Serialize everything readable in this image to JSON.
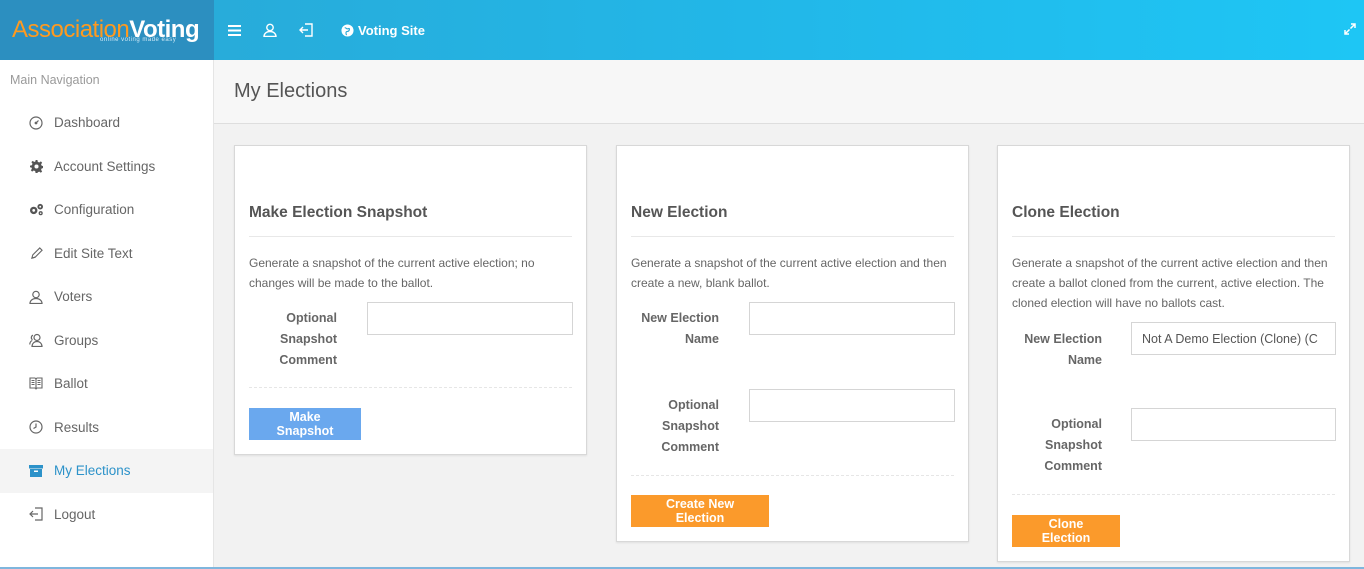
{
  "brand": {
    "part1": "Association",
    "part2": "Voting",
    "tagline": "online voting made easy"
  },
  "topbar": {
    "voting_site": "Voting Site"
  },
  "sidebar": {
    "header": "Main Navigation",
    "items": [
      {
        "label": "Dashboard",
        "icon": "dashboard-icon"
      },
      {
        "label": "Account Settings",
        "icon": "gear-icon"
      },
      {
        "label": "Configuration",
        "icon": "gears-icon"
      },
      {
        "label": "Edit Site Text",
        "icon": "pencil-icon"
      },
      {
        "label": "Voters",
        "icon": "user-icon"
      },
      {
        "label": "Groups",
        "icon": "users-icon"
      },
      {
        "label": "Ballot",
        "icon": "book-icon"
      },
      {
        "label": "Results",
        "icon": "clock-icon"
      },
      {
        "label": "My Elections",
        "icon": "archive-icon",
        "active": true
      },
      {
        "label": "Logout",
        "icon": "logout-icon"
      }
    ]
  },
  "page": {
    "title": "My Elections"
  },
  "cards": {
    "snapshot": {
      "title": "Make Election Snapshot",
      "description": "Generate a snapshot of the current active election; no changes will be made to the ballot.",
      "comment_label": "Optional Snapshot Comment",
      "comment_value": "",
      "button": "Make Snapshot"
    },
    "new_election": {
      "title": "New Election",
      "description": "Generate a snapshot of the current active election and then create a new, blank ballot.",
      "name_label": "New Election Name",
      "name_value": "",
      "comment_label": "Optional Snapshot Comment",
      "comment_value": "",
      "button": "Create New Election"
    },
    "clone_election": {
      "title": "Clone Election",
      "description": "Generate a snapshot of the current active election and then create a ballot cloned from the current, active election. The cloned election will have no ballots cast.",
      "name_label": "New Election Name",
      "name_value": "Not A Demo Election (Clone) (C",
      "comment_label": "Optional Snapshot Comment",
      "comment_value": "",
      "button": "Clone Election"
    }
  },
  "colors": {
    "topbar": "#22b7e8",
    "logo_bg": "#2c8fc0",
    "accent_orange": "#fb9a2b",
    "button_blue": "#6aa8ee",
    "active_link": "#2c92c9"
  }
}
